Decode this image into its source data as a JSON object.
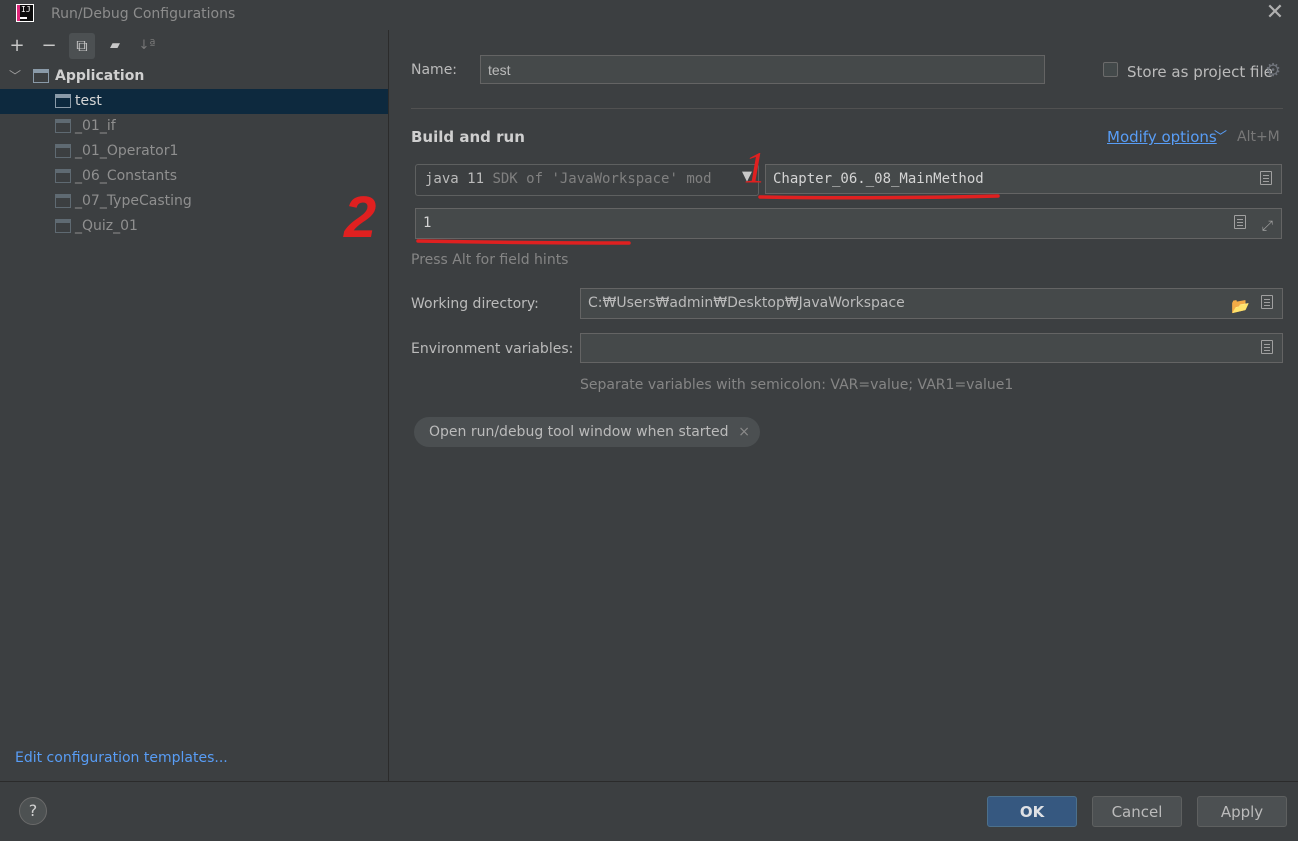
{
  "window": {
    "title": "Run/Debug Configurations",
    "close_glyph": "✕"
  },
  "toolbar": {
    "add": "+",
    "remove": "−",
    "copy": "⧉",
    "folder": "▰",
    "sort": "↓ª"
  },
  "tree": {
    "group_label": "Application",
    "items": [
      {
        "label": "test"
      },
      {
        "label": "_01_if"
      },
      {
        "label": "_01_Operator1"
      },
      {
        "label": "_06_Constants"
      },
      {
        "label": "_07_TypeCasting"
      },
      {
        "label": "_Quiz_01"
      }
    ]
  },
  "edit_templates_link": "Edit configuration templates...",
  "form": {
    "name_label": "Name:",
    "name_value": "test",
    "store_label": "Store as project file",
    "section_title": "Build and run",
    "modify_options": "Modify options",
    "modify_shortcut": "Alt+M",
    "sdk_main": "java 11",
    "sdk_detail": "SDK of 'JavaWorkspace' mod",
    "main_class": "Chapter_06._08_MainMethod",
    "program_args": "1",
    "hint": "Press Alt for field hints",
    "working_dir_label": "Working directory:",
    "working_dir_value": "C:₩Users₩admin₩Desktop₩JavaWorkspace",
    "env_label": "Environment variables:",
    "env_value": "",
    "env_hint": "Separate variables with semicolon: VAR=value; VAR1=value1",
    "chip_label": "Open run/debug tool window when started",
    "chip_close": "×"
  },
  "buttons": {
    "help": "?",
    "ok": "OK",
    "cancel": "Cancel",
    "apply": "Apply"
  },
  "annotations": {
    "mark1": "1",
    "mark2": "2",
    "color": "#e02020"
  },
  "colors": {
    "accent_link": "#589df6",
    "selection": "#0d293e",
    "primary_button": "#365880"
  }
}
